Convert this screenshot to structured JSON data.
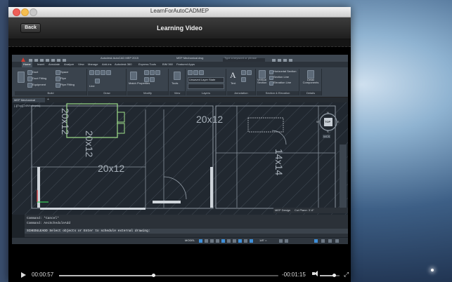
{
  "window": {
    "title": "LearnForAutoCADMEP"
  },
  "navbar": {
    "back_label": "Back",
    "title": "Learning Video"
  },
  "cad": {
    "app_title": "Autodesk AutoCAD MEP 2015",
    "file_title": "MEP Mechanical.dwg",
    "search_placeholder": "Type a keyword or phrase",
    "ribbon_tabs": [
      "Home",
      "Insert",
      "Annotate",
      "Analyze",
      "View",
      "Manage",
      "Add-ins",
      "Autodesk 360",
      "Express Tools",
      "BIM 360",
      "Featured Apps"
    ],
    "panels": {
      "build": {
        "label": "Build",
        "items": [
          "Duct",
          "Duct Fitting",
          "Equipment",
          "Space",
          "Pipe",
          "Pipe Fitting"
        ]
      },
      "draw": {
        "label": "Draw",
        "items": [
          "Line"
        ]
      },
      "modify": {
        "label": "Modify",
        "items": [
          "Match Properties"
        ]
      },
      "view": {
        "label": "View",
        "items": [
          "Tools"
        ]
      },
      "layers": {
        "label": "Layers",
        "items": [
          "Unsaved Layer State"
        ]
      },
      "annotation": {
        "label": "Annotation",
        "items": [
          "Text"
        ]
      },
      "section": {
        "label": "Section & Elevation",
        "items": [
          "Vertical Section",
          "Horizontal Section",
          "Section Line",
          "Elevation Line"
        ]
      },
      "details": {
        "label": "Details",
        "items": [
          "Detail Components"
        ]
      }
    },
    "doc_tab": "MEP Mechanical",
    "viewport_label": "[-][Top][2dWireframe]",
    "room_labels": [
      "20x12",
      "20x12",
      "20x12",
      "20x12",
      "14x14"
    ],
    "compass": {
      "center": "TOP",
      "n": "N",
      "e": "E",
      "w": "W",
      "s": "S",
      "wcs": "WCS"
    },
    "command_lines": [
      "Command: *Cancel*",
      "Command: AecScheduleAdd"
    ],
    "command_prompt": "SCHEDULEADD Select objects or Enter to schedule external drawing:",
    "status": {
      "model": "MODEL",
      "scale": "1/8\" =",
      "cut_plane": "Cut Plane: 3'-6\"",
      "display": "MEP Design"
    }
  },
  "player": {
    "elapsed": "00:00:57",
    "remaining": "-00:01:15",
    "progress": 0.43,
    "volume": 0.7
  }
}
